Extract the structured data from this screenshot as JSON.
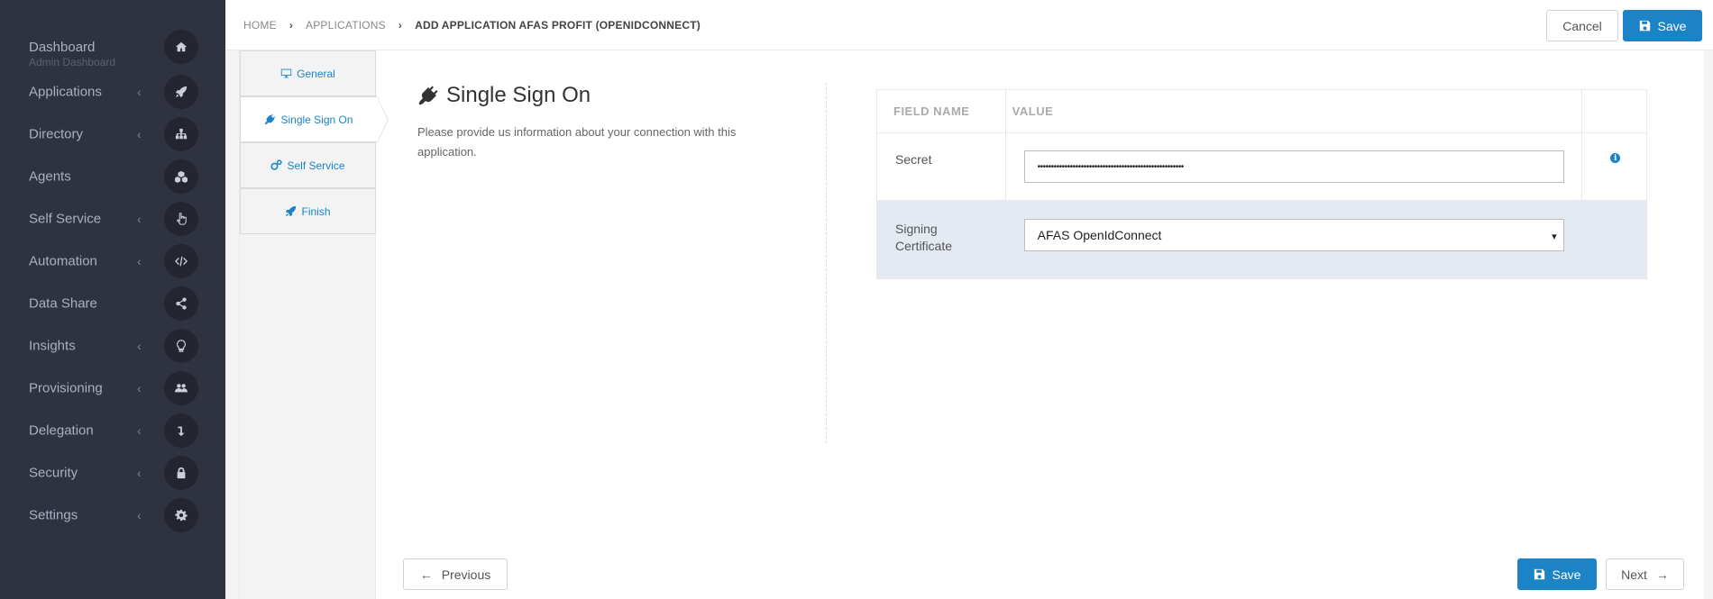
{
  "sidebar": {
    "items": [
      {
        "label": "Dashboard",
        "sub": "Admin Dashboard",
        "icon": "home-icon",
        "chevron": false
      },
      {
        "label": "Applications",
        "icon": "rocket-icon",
        "chevron": true
      },
      {
        "label": "Directory",
        "icon": "sitemap-icon",
        "chevron": true
      },
      {
        "label": "Agents",
        "icon": "cubes-icon",
        "chevron": false
      },
      {
        "label": "Self Service",
        "icon": "hand-pointer-icon",
        "chevron": true
      },
      {
        "label": "Automation",
        "icon": "code-icon",
        "chevron": true
      },
      {
        "label": "Data Share",
        "icon": "share-icon",
        "chevron": false
      },
      {
        "label": "Insights",
        "icon": "lightbulb-icon",
        "chevron": true
      },
      {
        "label": "Provisioning",
        "icon": "users-icon",
        "chevron": true
      },
      {
        "label": "Delegation",
        "icon": "level-down-icon",
        "chevron": true
      },
      {
        "label": "Security",
        "icon": "lock-icon",
        "chevron": true
      },
      {
        "label": "Settings",
        "icon": "gear-icon",
        "chevron": true
      }
    ],
    "chevron_glyph": "‹"
  },
  "breadcrumb": {
    "home": "HOME",
    "applications": "APPLICATIONS",
    "current": "ADD APPLICATION AFAS PROFIT (OPENIDCONNECT)",
    "separator": "›"
  },
  "header": {
    "cancel_label": "Cancel",
    "save_label": "Save"
  },
  "steps": [
    {
      "label": "General",
      "icon": "desktop-icon",
      "active": false
    },
    {
      "label": "Single Sign On",
      "icon": "plug-icon",
      "active": true
    },
    {
      "label": "Self Service",
      "icon": "cogs-icon",
      "active": false
    },
    {
      "label": "Finish",
      "icon": "rocket-icon",
      "active": false
    }
  ],
  "section": {
    "title": "Single Sign On",
    "description": "Please provide us information about your connection with this application."
  },
  "table": {
    "headers": [
      "FIELD NAME",
      "VALUE"
    ],
    "rows": [
      {
        "field": "Secret",
        "value": "••••••••••••••••••••••••••••••••••••••••••••••••••••••",
        "type": "password",
        "info": "i"
      },
      {
        "field": "Signing Certificate",
        "value": "AFAS OpenIdConnect",
        "type": "select",
        "caret": "▾"
      }
    ]
  },
  "footer": {
    "previous_label": "Previous",
    "save_label": "Save",
    "next_label": "Next"
  },
  "colors": {
    "sidebar_bg": "#2f3340",
    "accent": "#1c84c6",
    "row_highlight": "#e4eaf1"
  }
}
